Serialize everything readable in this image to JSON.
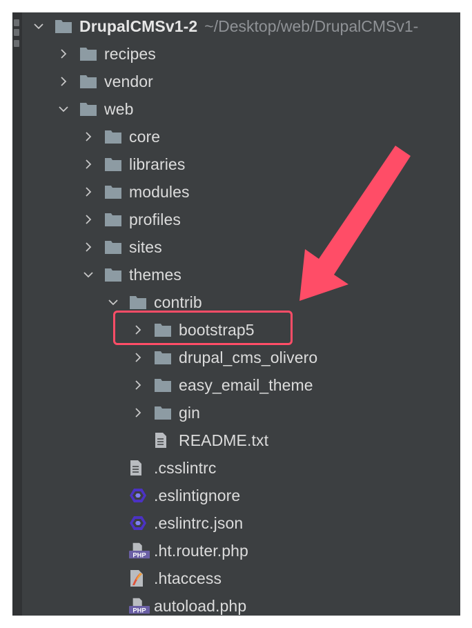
{
  "project": {
    "name": "DrupalCMSv1-2",
    "path": "~/Desktop/web/DrupalCMSv1-"
  },
  "items": [
    {
      "label": "recipes",
      "type": "folder",
      "state": "collapsed",
      "level": 1
    },
    {
      "label": "vendor",
      "type": "folder",
      "state": "collapsed",
      "level": 1
    },
    {
      "label": "web",
      "type": "folder",
      "state": "expanded",
      "level": 1
    },
    {
      "label": "core",
      "type": "folder",
      "state": "collapsed",
      "level": 2
    },
    {
      "label": "libraries",
      "type": "folder",
      "state": "collapsed",
      "level": 2
    },
    {
      "label": "modules",
      "type": "folder",
      "state": "collapsed",
      "level": 2
    },
    {
      "label": "profiles",
      "type": "folder",
      "state": "collapsed",
      "level": 2
    },
    {
      "label": "sites",
      "type": "folder",
      "state": "collapsed",
      "level": 2
    },
    {
      "label": "themes",
      "type": "folder",
      "state": "expanded",
      "level": 2
    },
    {
      "label": "contrib",
      "type": "folder",
      "state": "expanded",
      "level": 3
    },
    {
      "label": "bootstrap5",
      "type": "folder",
      "state": "collapsed",
      "level": 4
    },
    {
      "label": "drupal_cms_olivero",
      "type": "folder",
      "state": "collapsed",
      "level": 4
    },
    {
      "label": "easy_email_theme",
      "type": "folder",
      "state": "collapsed",
      "level": 4
    },
    {
      "label": "gin",
      "type": "folder",
      "state": "collapsed",
      "level": 4
    },
    {
      "label": "README.txt",
      "type": "text-file",
      "level": 4
    },
    {
      "label": ".csslintrc",
      "type": "text-file",
      "level": 3
    },
    {
      "label": ".eslintignore",
      "type": "eslint-file",
      "level": 3
    },
    {
      "label": ".eslintrc.json",
      "type": "eslint-file",
      "level": 3
    },
    {
      "label": ".ht.router.php",
      "type": "php-file",
      "level": 3
    },
    {
      "label": ".htaccess",
      "type": "htaccess-file",
      "level": 3
    },
    {
      "label": "autoload.php",
      "type": "php-file",
      "level": 3
    }
  ],
  "icons": {
    "folder": "folder-icon",
    "text-file": "text-file-icon",
    "eslint-file": "eslint-icon",
    "php-file": "php-file-icon",
    "htaccess-file": "htaccess-icon",
    "php_badge": "PHP"
  },
  "annotation": {
    "highlighted_item": "bootstrap5",
    "box_color": "#ff4d67",
    "arrow_color": "#ff4d67"
  },
  "colors": {
    "panel": "#3c3f41",
    "text": "#dcdcdc",
    "path_text": "#8f9296",
    "folder": "#8d9ba3",
    "eslint": "#4b32c3"
  }
}
